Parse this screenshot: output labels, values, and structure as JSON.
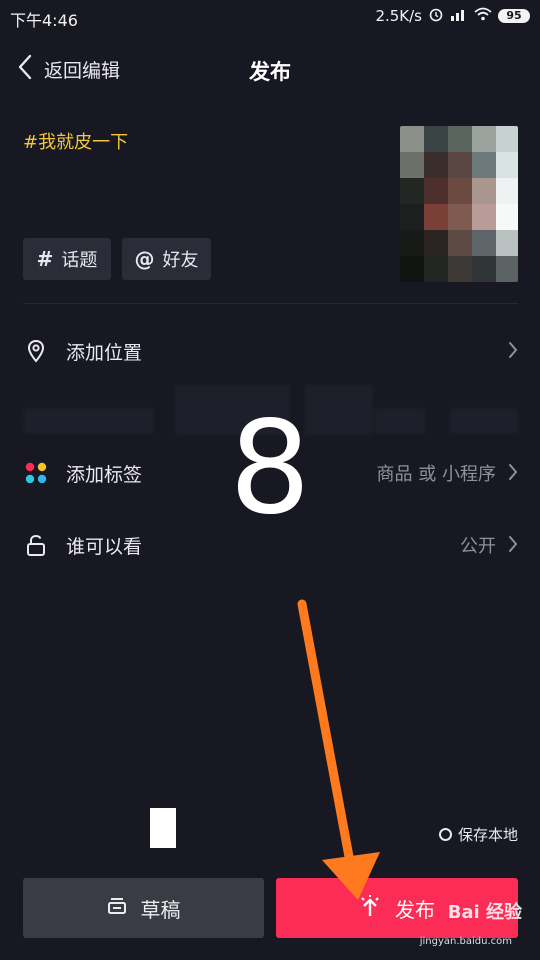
{
  "status_bar": {
    "time": "下午4:46",
    "network_speed": "2.5K/s",
    "battery": "95"
  },
  "nav": {
    "back_label": "返回编辑",
    "title": "发布"
  },
  "post": {
    "caption": "#我就皮一下"
  },
  "tag_buttons": {
    "topic_symbol": "#",
    "topic_label": "话题",
    "friend_symbol": "@",
    "friend_label": "好友"
  },
  "rows": {
    "location": {
      "label": "添加位置"
    },
    "tags": {
      "label": "添加标签",
      "value": "商品 或 小程序"
    },
    "visibility": {
      "label": "谁可以看",
      "value": "公开"
    }
  },
  "overlay": {
    "step_number": "8"
  },
  "save_local": {
    "label": "保存本地"
  },
  "buttons": {
    "draft_label": "草稿",
    "publish_label": "发布"
  },
  "watermark": {
    "text": "Bai 经验",
    "url": "jingyan.baidu.com"
  },
  "colors": {
    "accent_red": "#fb2c55",
    "caption_yellow": "#f4c63c",
    "annotation_orange": "#ff7a1f"
  },
  "icons": [
    "chevron-left-icon",
    "location-pin-icon",
    "tag-dots-icon",
    "lock-icon",
    "chevron-right-icon",
    "draft-icon",
    "upload-icon"
  ]
}
